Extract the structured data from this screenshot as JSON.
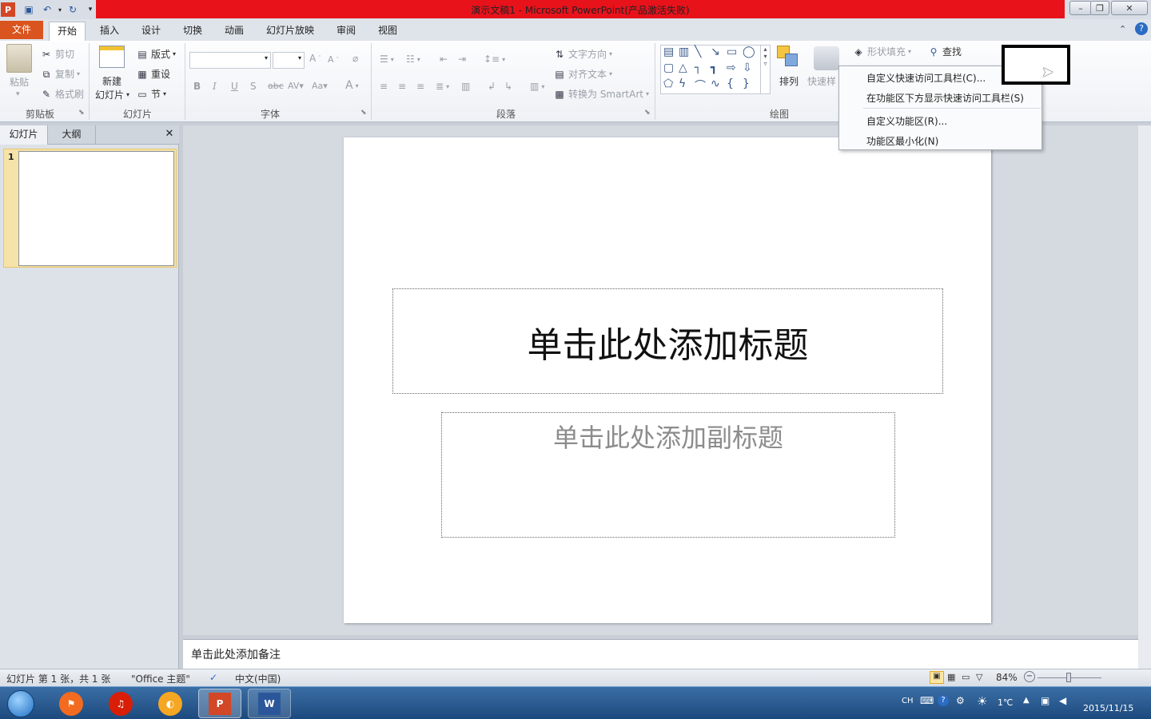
{
  "window": {
    "title": "演示文稿1 - Microsoft PowerPoint(产品激活失败)",
    "minimize": "–",
    "restore": "❐",
    "close": "✕"
  },
  "tabs": {
    "file": "文件",
    "items": [
      "开始",
      "插入",
      "设计",
      "切换",
      "动画",
      "幻灯片放映",
      "审阅",
      "视图"
    ]
  },
  "ribbon": {
    "clipboard": {
      "label": "剪贴板",
      "paste": "粘贴",
      "cut": "剪切",
      "copy": "复制",
      "format_painter": "格式刷"
    },
    "slides": {
      "label": "幻灯片",
      "new_slide_line1": "新建",
      "new_slide_line2": "幻灯片",
      "layout": "版式",
      "reset": "重设",
      "section": "节"
    },
    "font": {
      "label": "字体"
    },
    "paragraph": {
      "label": "段落",
      "text_direction": "文字方向",
      "align_text": "对齐文本",
      "convert_smartart": "转换为 SmartArt"
    },
    "drawing": {
      "label": "绘图",
      "arrange": "排列",
      "quick_styles": "快速样",
      "shape_fill": "形状填充"
    },
    "editing": {
      "find": "查找"
    }
  },
  "context_menu": {
    "items": [
      "自定义快速访问工具栏(C)...",
      "在功能区下方显示快速访问工具栏(S)",
      "自定义功能区(R)...",
      "功能区最小化(N)"
    ]
  },
  "left_pane": {
    "tab_slides": "幻灯片",
    "tab_outline": "大纲",
    "close": "✕",
    "slide_number": "1"
  },
  "slide": {
    "title_placeholder": "单击此处添加标题",
    "subtitle_placeholder": "单击此处添加副标题"
  },
  "notes": {
    "placeholder": "单击此处添加备注"
  },
  "status": {
    "slide_info": "幻灯片 第 1 张，共 1 张",
    "theme": "\"Office 主题\"",
    "language": "中文(中国)",
    "zoom": "84%"
  },
  "taskbar": {
    "ime": "CH",
    "temperature": "1℃",
    "date": "2015/11/15"
  },
  "colors": {
    "title_bar_red": "#e8121b",
    "file_tab": "#d9541e",
    "taskbar": "#1d4a7e"
  }
}
